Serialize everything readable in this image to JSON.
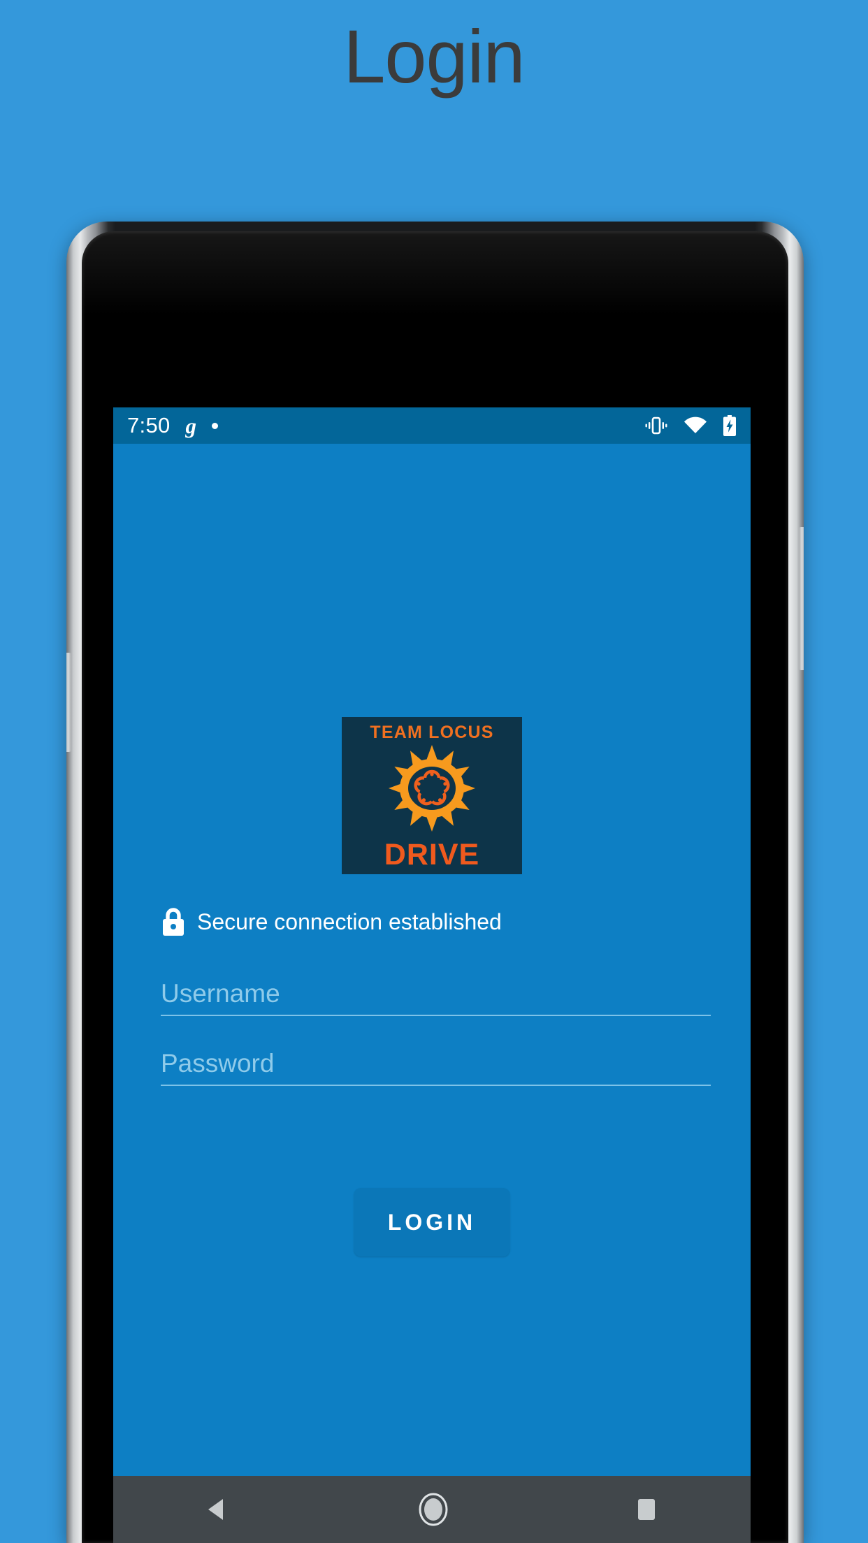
{
  "page": {
    "title": "Login",
    "background_color": "#3498db"
  },
  "device": {
    "frame_color": "#c9ccce",
    "screen_background": "#0d7fc4",
    "camera_icon": "front-camera-icon",
    "earpiece_icon": "earpiece-speaker-icon",
    "power_button": "power-button",
    "volume_button": "volume-button"
  },
  "status_bar": {
    "background_color": "#036699",
    "time": "7:50",
    "notification_icon": "g",
    "notification_dot": "•",
    "icons": [
      {
        "name": "vibrate-icon"
      },
      {
        "name": "wifi-icon"
      },
      {
        "name": "battery-charging-icon"
      }
    ]
  },
  "app": {
    "logo": {
      "top_text": "TEAM LOCUS",
      "bottom_text": "DRIVE",
      "symbol": "sun-icon",
      "card_color": "#0d3449",
      "accent_color": "#f07020",
      "bottom_text_color": "#f05a1e"
    },
    "secure_notice": {
      "icon": "lock-icon",
      "text": "Secure connection established"
    },
    "form": {
      "username": {
        "placeholder": "Username",
        "value": ""
      },
      "password": {
        "placeholder": "Password",
        "value": ""
      },
      "submit_label": "LOGIN"
    }
  },
  "nav_bar": {
    "background_color": "#41474b",
    "buttons": [
      {
        "name": "back-button",
        "icon": "triangle-left-icon"
      },
      {
        "name": "home-button",
        "icon": "circle-icon"
      },
      {
        "name": "recents-button",
        "icon": "square-icon"
      }
    ]
  }
}
